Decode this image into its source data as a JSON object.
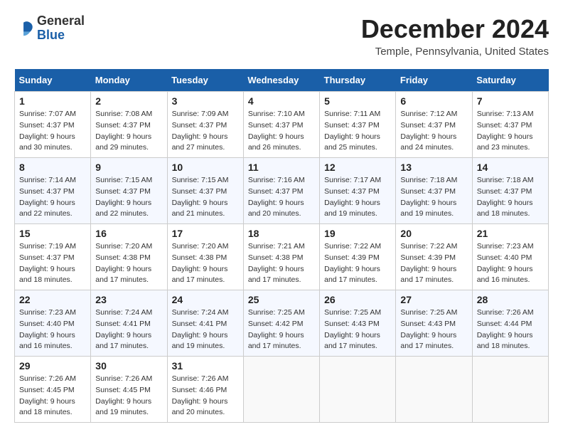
{
  "app": {
    "name_general": "General",
    "name_blue": "Blue"
  },
  "header": {
    "month": "December 2024",
    "location": "Temple, Pennsylvania, United States"
  },
  "columns": [
    "Sunday",
    "Monday",
    "Tuesday",
    "Wednesday",
    "Thursday",
    "Friday",
    "Saturday"
  ],
  "weeks": [
    [
      {
        "day": "1",
        "sunrise": "Sunrise: 7:07 AM",
        "sunset": "Sunset: 4:37 PM",
        "daylight": "Daylight: 9 hours and 30 minutes."
      },
      {
        "day": "2",
        "sunrise": "Sunrise: 7:08 AM",
        "sunset": "Sunset: 4:37 PM",
        "daylight": "Daylight: 9 hours and 29 minutes."
      },
      {
        "day": "3",
        "sunrise": "Sunrise: 7:09 AM",
        "sunset": "Sunset: 4:37 PM",
        "daylight": "Daylight: 9 hours and 27 minutes."
      },
      {
        "day": "4",
        "sunrise": "Sunrise: 7:10 AM",
        "sunset": "Sunset: 4:37 PM",
        "daylight": "Daylight: 9 hours and 26 minutes."
      },
      {
        "day": "5",
        "sunrise": "Sunrise: 7:11 AM",
        "sunset": "Sunset: 4:37 PM",
        "daylight": "Daylight: 9 hours and 25 minutes."
      },
      {
        "day": "6",
        "sunrise": "Sunrise: 7:12 AM",
        "sunset": "Sunset: 4:37 PM",
        "daylight": "Daylight: 9 hours and 24 minutes."
      },
      {
        "day": "7",
        "sunrise": "Sunrise: 7:13 AM",
        "sunset": "Sunset: 4:37 PM",
        "daylight": "Daylight: 9 hours and 23 minutes."
      }
    ],
    [
      {
        "day": "8",
        "sunrise": "Sunrise: 7:14 AM",
        "sunset": "Sunset: 4:37 PM",
        "daylight": "Daylight: 9 hours and 22 minutes."
      },
      {
        "day": "9",
        "sunrise": "Sunrise: 7:15 AM",
        "sunset": "Sunset: 4:37 PM",
        "daylight": "Daylight: 9 hours and 22 minutes."
      },
      {
        "day": "10",
        "sunrise": "Sunrise: 7:15 AM",
        "sunset": "Sunset: 4:37 PM",
        "daylight": "Daylight: 9 hours and 21 minutes."
      },
      {
        "day": "11",
        "sunrise": "Sunrise: 7:16 AM",
        "sunset": "Sunset: 4:37 PM",
        "daylight": "Daylight: 9 hours and 20 minutes."
      },
      {
        "day": "12",
        "sunrise": "Sunrise: 7:17 AM",
        "sunset": "Sunset: 4:37 PM",
        "daylight": "Daylight: 9 hours and 19 minutes."
      },
      {
        "day": "13",
        "sunrise": "Sunrise: 7:18 AM",
        "sunset": "Sunset: 4:37 PM",
        "daylight": "Daylight: 9 hours and 19 minutes."
      },
      {
        "day": "14",
        "sunrise": "Sunrise: 7:18 AM",
        "sunset": "Sunset: 4:37 PM",
        "daylight": "Daylight: 9 hours and 18 minutes."
      }
    ],
    [
      {
        "day": "15",
        "sunrise": "Sunrise: 7:19 AM",
        "sunset": "Sunset: 4:37 PM",
        "daylight": "Daylight: 9 hours and 18 minutes."
      },
      {
        "day": "16",
        "sunrise": "Sunrise: 7:20 AM",
        "sunset": "Sunset: 4:38 PM",
        "daylight": "Daylight: 9 hours and 17 minutes."
      },
      {
        "day": "17",
        "sunrise": "Sunrise: 7:20 AM",
        "sunset": "Sunset: 4:38 PM",
        "daylight": "Daylight: 9 hours and 17 minutes."
      },
      {
        "day": "18",
        "sunrise": "Sunrise: 7:21 AM",
        "sunset": "Sunset: 4:38 PM",
        "daylight": "Daylight: 9 hours and 17 minutes."
      },
      {
        "day": "19",
        "sunrise": "Sunrise: 7:22 AM",
        "sunset": "Sunset: 4:39 PM",
        "daylight": "Daylight: 9 hours and 17 minutes."
      },
      {
        "day": "20",
        "sunrise": "Sunrise: 7:22 AM",
        "sunset": "Sunset: 4:39 PM",
        "daylight": "Daylight: 9 hours and 17 minutes."
      },
      {
        "day": "21",
        "sunrise": "Sunrise: 7:23 AM",
        "sunset": "Sunset: 4:40 PM",
        "daylight": "Daylight: 9 hours and 16 minutes."
      }
    ],
    [
      {
        "day": "22",
        "sunrise": "Sunrise: 7:23 AM",
        "sunset": "Sunset: 4:40 PM",
        "daylight": "Daylight: 9 hours and 16 minutes."
      },
      {
        "day": "23",
        "sunrise": "Sunrise: 7:24 AM",
        "sunset": "Sunset: 4:41 PM",
        "daylight": "Daylight: 9 hours and 17 minutes."
      },
      {
        "day": "24",
        "sunrise": "Sunrise: 7:24 AM",
        "sunset": "Sunset: 4:41 PM",
        "daylight": "Daylight: 9 hours and 19 minutes."
      },
      {
        "day": "25",
        "sunrise": "Sunrise: 7:25 AM",
        "sunset": "Sunset: 4:42 PM",
        "daylight": "Daylight: 9 hours and 17 minutes."
      },
      {
        "day": "26",
        "sunrise": "Sunrise: 7:25 AM",
        "sunset": "Sunset: 4:43 PM",
        "daylight": "Daylight: 9 hours and 17 minutes."
      },
      {
        "day": "27",
        "sunrise": "Sunrise: 7:25 AM",
        "sunset": "Sunset: 4:43 PM",
        "daylight": "Daylight: 9 hours and 17 minutes."
      },
      {
        "day": "28",
        "sunrise": "Sunrise: 7:26 AM",
        "sunset": "Sunset: 4:44 PM",
        "daylight": "Daylight: 9 hours and 18 minutes."
      }
    ],
    [
      {
        "day": "29",
        "sunrise": "Sunrise: 7:26 AM",
        "sunset": "Sunset: 4:45 PM",
        "daylight": "Daylight: 9 hours and 18 minutes."
      },
      {
        "day": "30",
        "sunrise": "Sunrise: 7:26 AM",
        "sunset": "Sunset: 4:45 PM",
        "daylight": "Daylight: 9 hours and 19 minutes."
      },
      {
        "day": "31",
        "sunrise": "Sunrise: 7:26 AM",
        "sunset": "Sunset: 4:46 PM",
        "daylight": "Daylight: 9 hours and 20 minutes."
      },
      null,
      null,
      null,
      null
    ]
  ]
}
